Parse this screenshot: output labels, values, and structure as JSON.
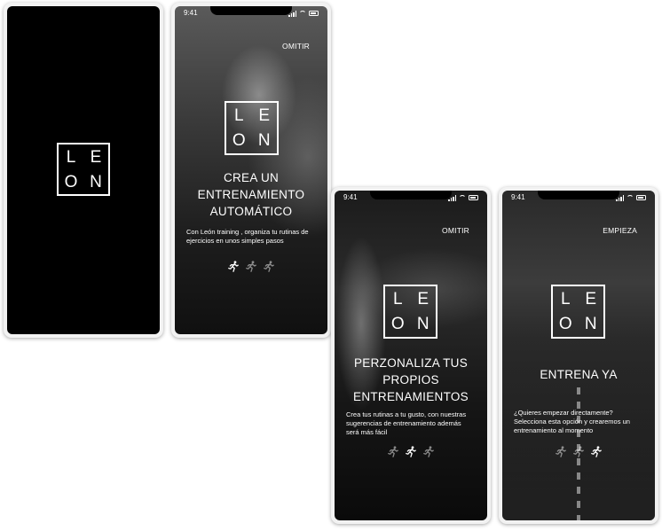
{
  "brand": {
    "logo_letters": [
      "L",
      "E",
      "O",
      "N"
    ]
  },
  "status_bar": {
    "time": "9:41"
  },
  "screens": [
    {
      "id": "splash"
    },
    {
      "id": "onboarding-1",
      "skip_label": "OMITIR",
      "title_lines": [
        "CREA UN",
        "ENTRENAMIENTO",
        "AUTOMÁTICO"
      ],
      "description_lines": [
        "Con León training , organiza tu rutinas de",
        "ejercicios en unos simples pasos"
      ],
      "active_step": 1
    },
    {
      "id": "onboarding-2",
      "skip_label": "OMITIR",
      "title_lines": [
        "PERZONALIZA TUS",
        "PROPIOS",
        "ENTRENAMIENTOS"
      ],
      "description_lines": [
        "Crea tus rutinas a tu gusto, con nuestras",
        "sugerencias de entrenamiento además",
        "será más fácil"
      ],
      "active_step": 2
    },
    {
      "id": "onboarding-3",
      "skip_label": "EMPIEZA",
      "title_lines": [
        "ENTRENA YA"
      ],
      "description_lines": [
        "¿Quieres empezar directamente?",
        "Selecciona esta opción y crearemos un",
        "entrenamiento al momento"
      ],
      "active_step": 3
    }
  ],
  "colors": {
    "background": "#ffffff",
    "screen_text": "#ffffff",
    "frame": "#f2f2f2"
  },
  "icons": {
    "step_indicator": "runner-icon"
  }
}
